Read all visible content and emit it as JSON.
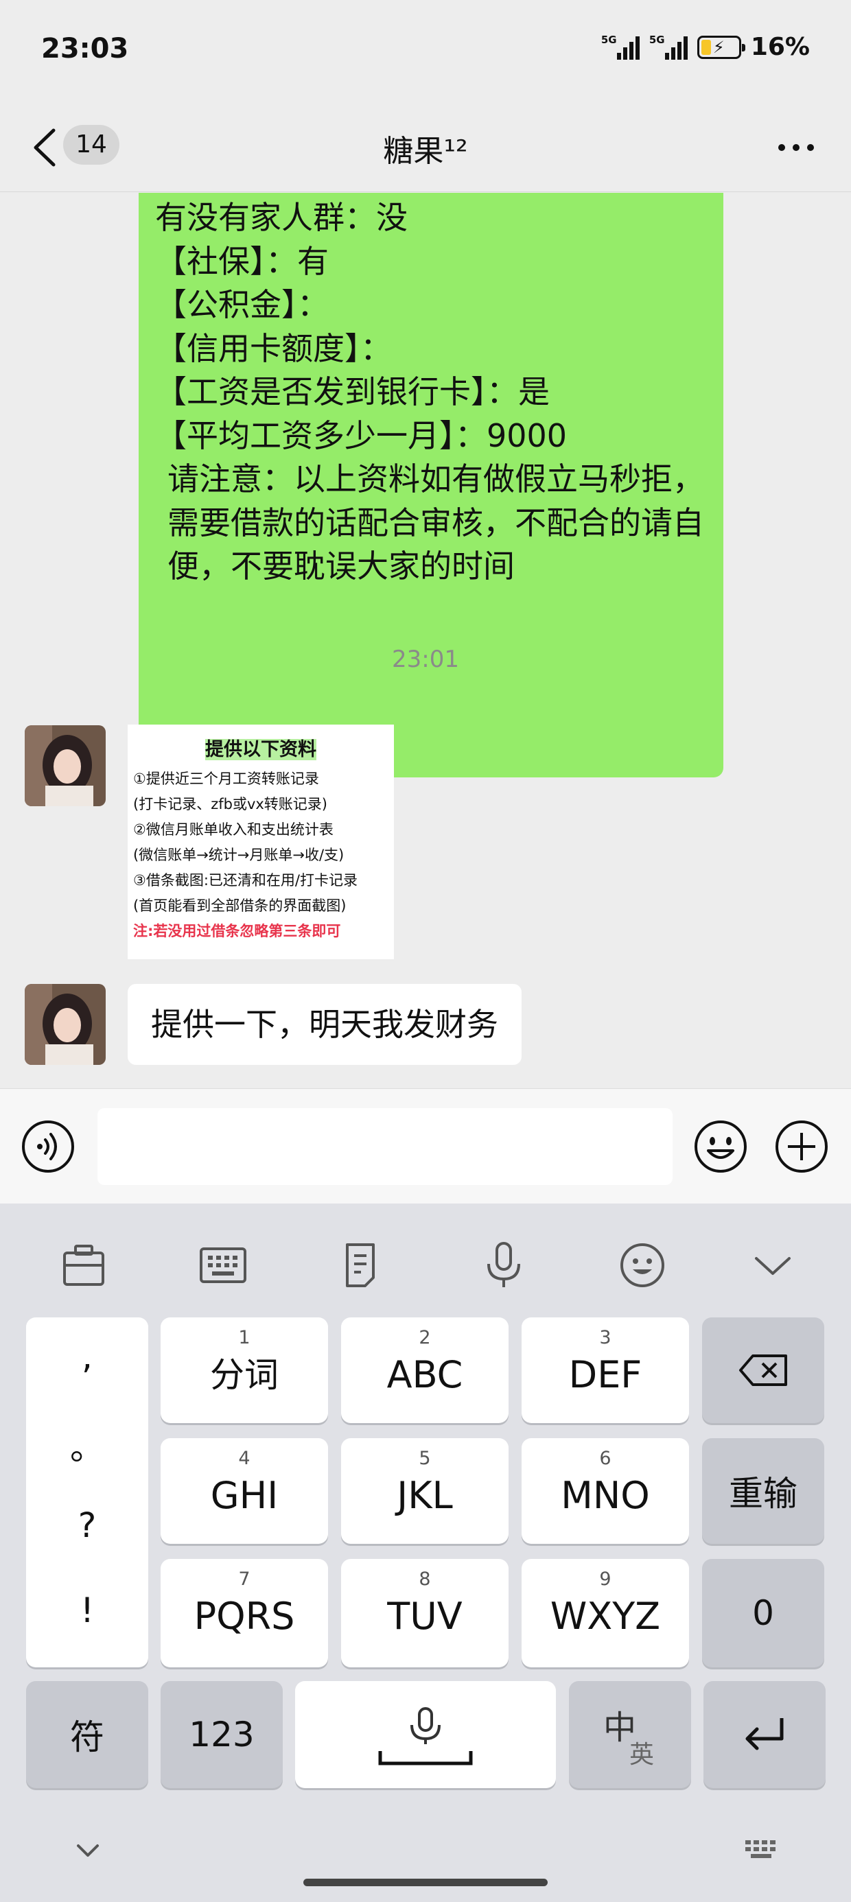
{
  "status_bar": {
    "time": "23:03",
    "sim1": "5G",
    "sim2": "5G",
    "battery": "16%"
  },
  "nav": {
    "unread_count": "14",
    "title": "糖果¹²"
  },
  "messages": {
    "green_lines": [
      "有没有家人群：没",
      "【社保】：有",
      "【公积金】：",
      "【信用卡额度】：",
      "【工资是否发到银行卡】：是",
      "【平均工资多少一月】：9000"
    ],
    "green_paragraph": "请注意：以上资料如有做假立马秒拒，需要借款的话配合审核，不配合的请自便，不要耽误大家的时间",
    "timestamp": "23:01",
    "image_card": {
      "title": "提供以下资料",
      "lines": [
        "①提供近三个月工资转账记录",
        "(打卡记录、zfb或vx转账记录)",
        "②微信月账单收入和支出统计表",
        "(微信账单→统计→月账单→收/支)",
        "③借条截图:已还清和在用/打卡记录",
        "(首页能看到全部借条的界面截图)"
      ],
      "note": "注:若没用过借条忽略第三条即可"
    },
    "white_text": "提供一下，明天我发财务"
  },
  "keyboard": {
    "punct": [
      ",",
      "。",
      "?",
      "!"
    ],
    "keys": [
      {
        "num": "1",
        "label": "分词"
      },
      {
        "num": "2",
        "label": "ABC"
      },
      {
        "num": "3",
        "label": "DEF"
      },
      {
        "num": "4",
        "label": "GHI"
      },
      {
        "num": "5",
        "label": "JKL"
      },
      {
        "num": "6",
        "label": "MNO"
      },
      {
        "num": "7",
        "label": "PQRS"
      },
      {
        "num": "8",
        "label": "TUV"
      },
      {
        "num": "9",
        "label": "WXYZ"
      }
    ],
    "reinput": "重输",
    "zero": "0",
    "symbol": "符",
    "num_mode": "123",
    "lang_main": "中",
    "lang_sub": "英"
  },
  "colors": {
    "sent_bubble": "#95ec69",
    "note_red": "#e8344c"
  }
}
